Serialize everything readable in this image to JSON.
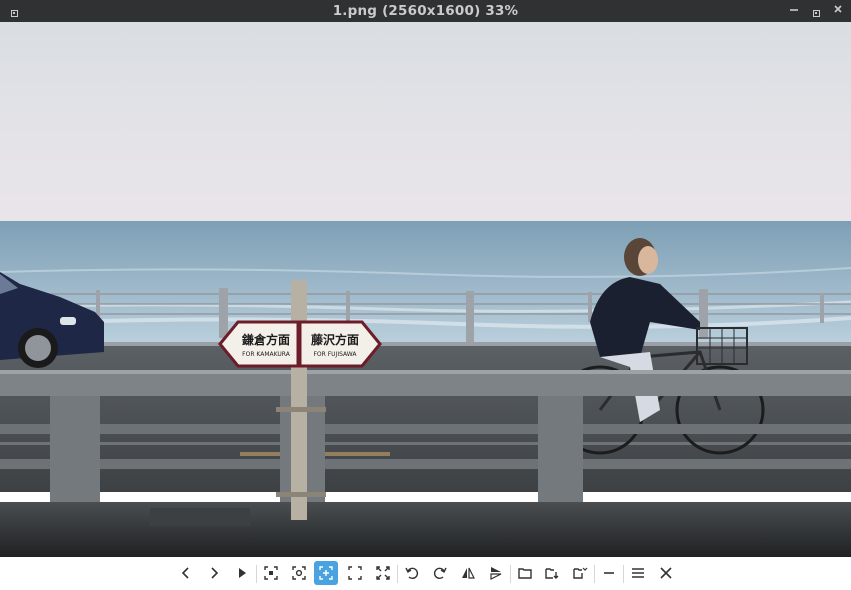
{
  "window": {
    "title": "1.png (2560x1600) 33%"
  },
  "photo": {
    "sign_left_jp": "鎌倉方面",
    "sign_left_en": "FOR KAMAKURA",
    "sign_right_jp": "藤沢方面",
    "sign_right_en": "FOR FUJISAWA"
  },
  "toolbar": {
    "active_tool": "zoom-fit-window",
    "accent_color": "#4aa3e0",
    "buttons": [
      "previous-image",
      "next-image",
      "slideshow",
      "zoom-original",
      "zoom-fit-width",
      "zoom-fit-window",
      "zoom-fit-height",
      "fullscreen",
      "rotate-left",
      "rotate-right",
      "flip-horizontal",
      "flip-vertical",
      "open-folder",
      "save-as",
      "copy-menu",
      "minimize",
      "menu",
      "close"
    ]
  }
}
